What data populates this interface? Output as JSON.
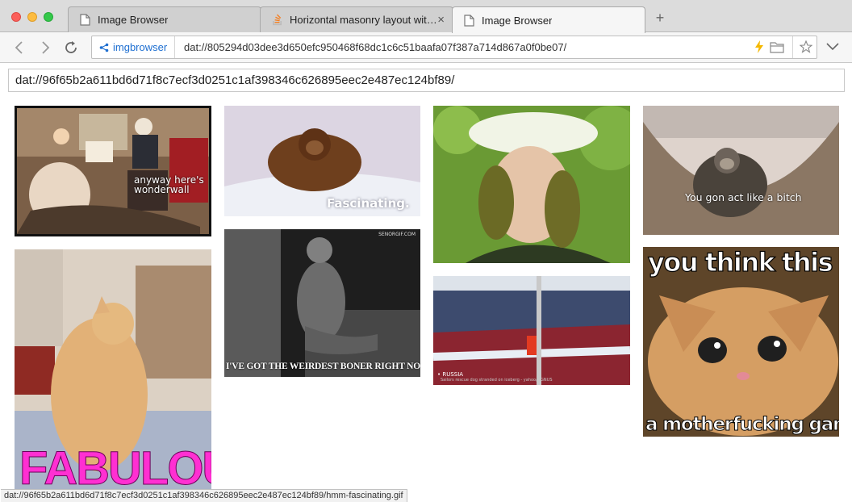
{
  "tabs": [
    {
      "label": "Image Browser",
      "icon": "page-icon",
      "active": false
    },
    {
      "label": "Horizontal masonry layout wit…",
      "icon": "stack-overflow-icon",
      "active": false
    },
    {
      "label": "Image Browser",
      "icon": "page-icon",
      "active": true
    }
  ],
  "new_tab_label": "+",
  "toolbar": {
    "origin_label": "imgbrowser",
    "url": "dat://805294d03dee3d650efc950468f68dc1c6c51baafa07f387a714d867a0f0be07/"
  },
  "page": {
    "archive_input_value": "dat://96f65b2a611bd6d71f8c7ecf3d0251c1af398346c626895eec2e487ec124bf89/"
  },
  "gallery": {
    "images": [
      {
        "caption": "anyway here's\nwonderwall"
      },
      {
        "caption": "FABULOUS"
      },
      {
        "caption": "Fascinating."
      },
      {
        "caption": "SENORGIF.COM",
        "caption2": "I'VE GOT THE WEIRDEST BONER RIGHT NOW"
      },
      {
        "caption": ""
      },
      {
        "caption": "• RUSSIA",
        "caption2": "Sailors rescue dog stranded on iceberg - yahoo/LIGNUS"
      },
      {
        "caption": "You gon act like a bitch"
      },
      {
        "caption": "you think this is",
        "caption2": "a motherfucking game?"
      }
    ]
  },
  "status_bar": {
    "text": "dat://96f65b2a611bd6d71f8c7ecf3d0251c1af398346c626895eec2e487ec124bf89/hmm-fascinating.gif"
  },
  "colors": {
    "accent": "#1e6fd1",
    "fabulous": "#ff2fd2"
  }
}
